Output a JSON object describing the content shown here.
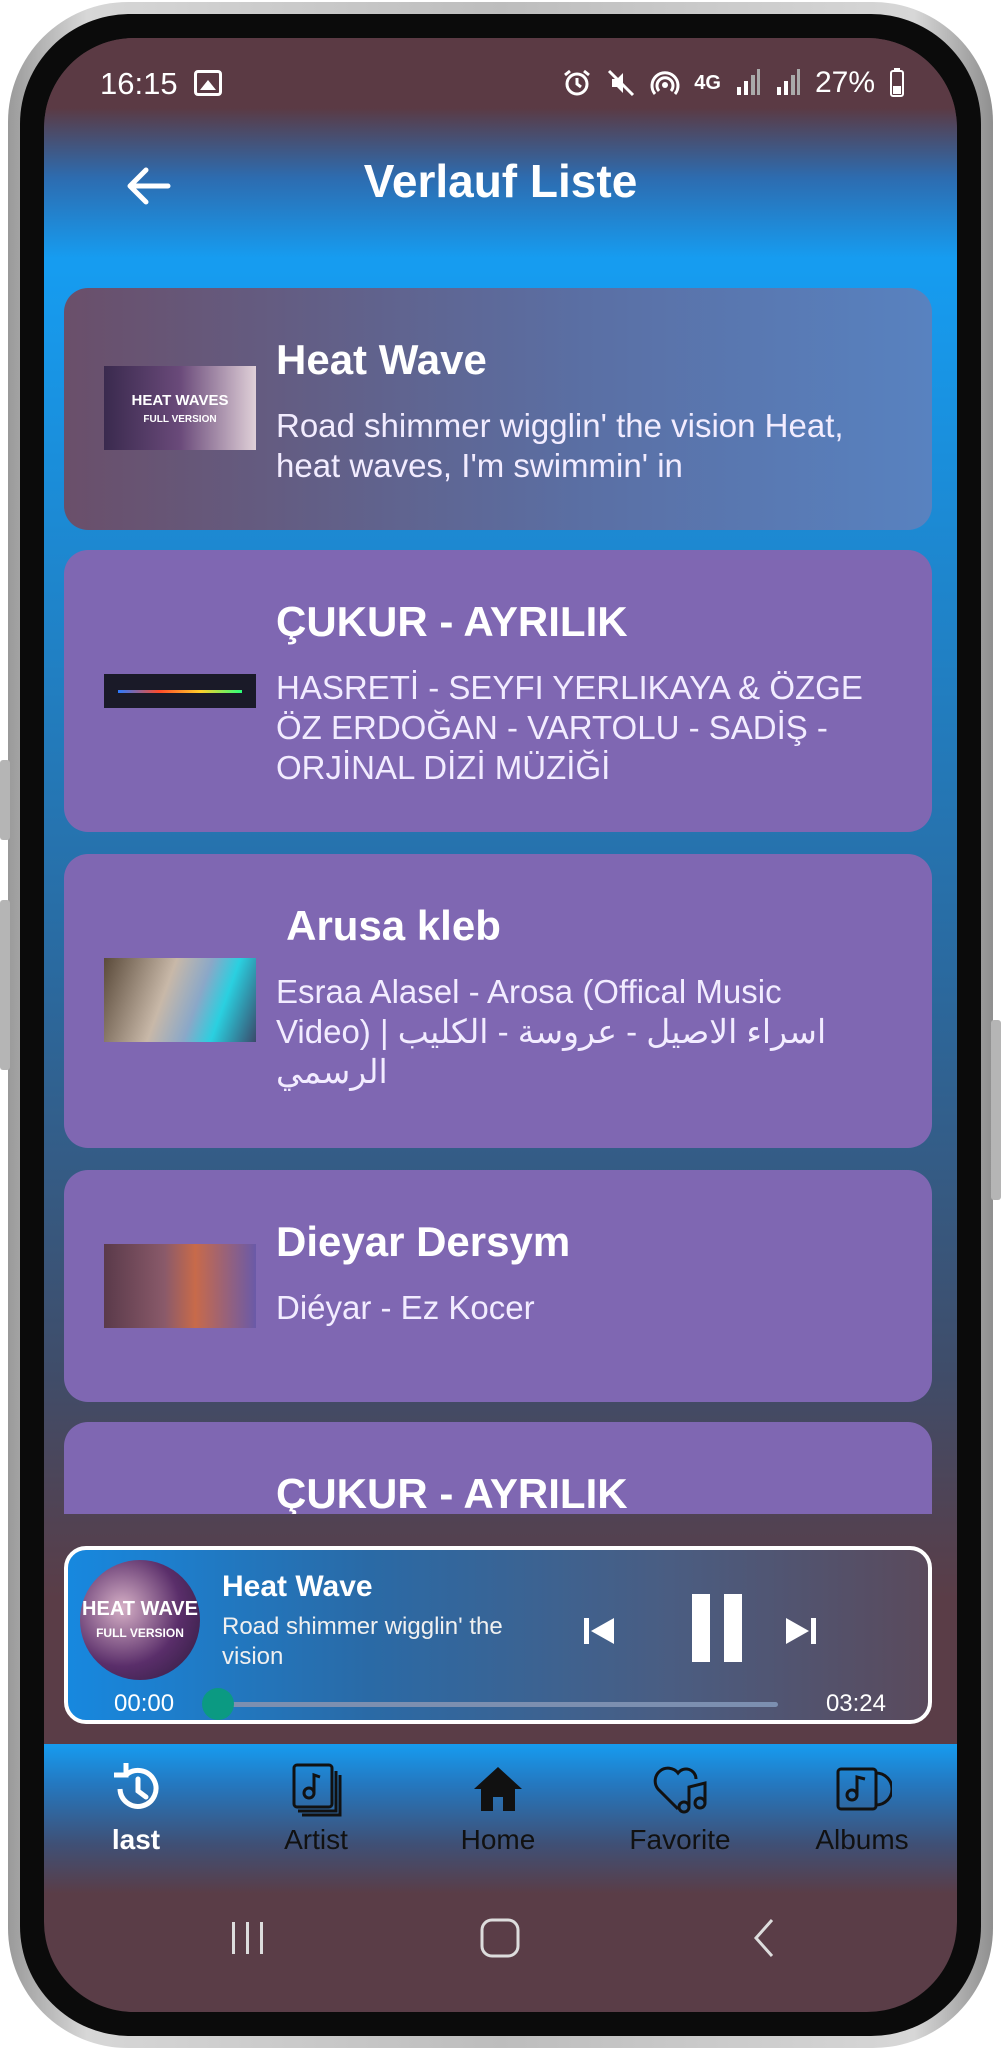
{
  "status_bar": {
    "time": "16:15",
    "battery": "27%",
    "icons": [
      "image-icon",
      "alarm-icon",
      "mute-icon",
      "hotspot-icon",
      "4g-icon",
      "signal-icon",
      "signal-icon",
      "battery-icon"
    ],
    "network": "4G"
  },
  "header": {
    "title": "Verlauf Liste"
  },
  "songs": [
    {
      "title": "Heat Wave",
      "subtitle": "Road shimmer wigglin' the vision Heat, heat waves, I'm swimmin' in",
      "thumb_text": "HEAT WAVES",
      "thumb_sub": "FULL VERSION"
    },
    {
      "title": "ÇUKUR - AYRILIK",
      "subtitle": "HASRETİ - SEYFI YERLIKAYA & ÖZGE ÖZ ERDOĞAN - VARTOLU - SADİŞ - ORJİNAL DİZİ MÜZİĞİ"
    },
    {
      "title": " Arusa kleb",
      "subtitle": "Esraa Alasel - Arosa (Offical Music Video) | اسراء الاصيل - عروسة - الكليب الرسمي"
    },
    {
      "title": "Dieyar Dersym",
      "subtitle": "Diéyar - Ez Kocer"
    },
    {
      "title": "ÇUKUR - AYRILIK",
      "subtitle": ""
    }
  ],
  "player": {
    "title": "Heat Wave",
    "subtitle": "Road shimmer wigglin' the vision",
    "time_current": "00:00",
    "time_total": "03:24",
    "progress": 0.0,
    "art_text": "HEAT WAVE",
    "art_sub": "FULL VERSION"
  },
  "nav": {
    "items": [
      {
        "label": "last",
        "icon": "history-icon",
        "active": true
      },
      {
        "label": "Artist",
        "icon": "album-stack-icon",
        "active": false
      },
      {
        "label": "Home",
        "icon": "home-icon",
        "active": false
      },
      {
        "label": "Favorite",
        "icon": "heart-music-icon",
        "active": false
      },
      {
        "label": "Albums",
        "icon": "albums-icon",
        "active": false
      }
    ]
  },
  "colors": {
    "accent": "#169cf0",
    "card": "#7f67b2",
    "frame_dark": "#5a3d47",
    "progress_knob": "#0b9a82"
  }
}
